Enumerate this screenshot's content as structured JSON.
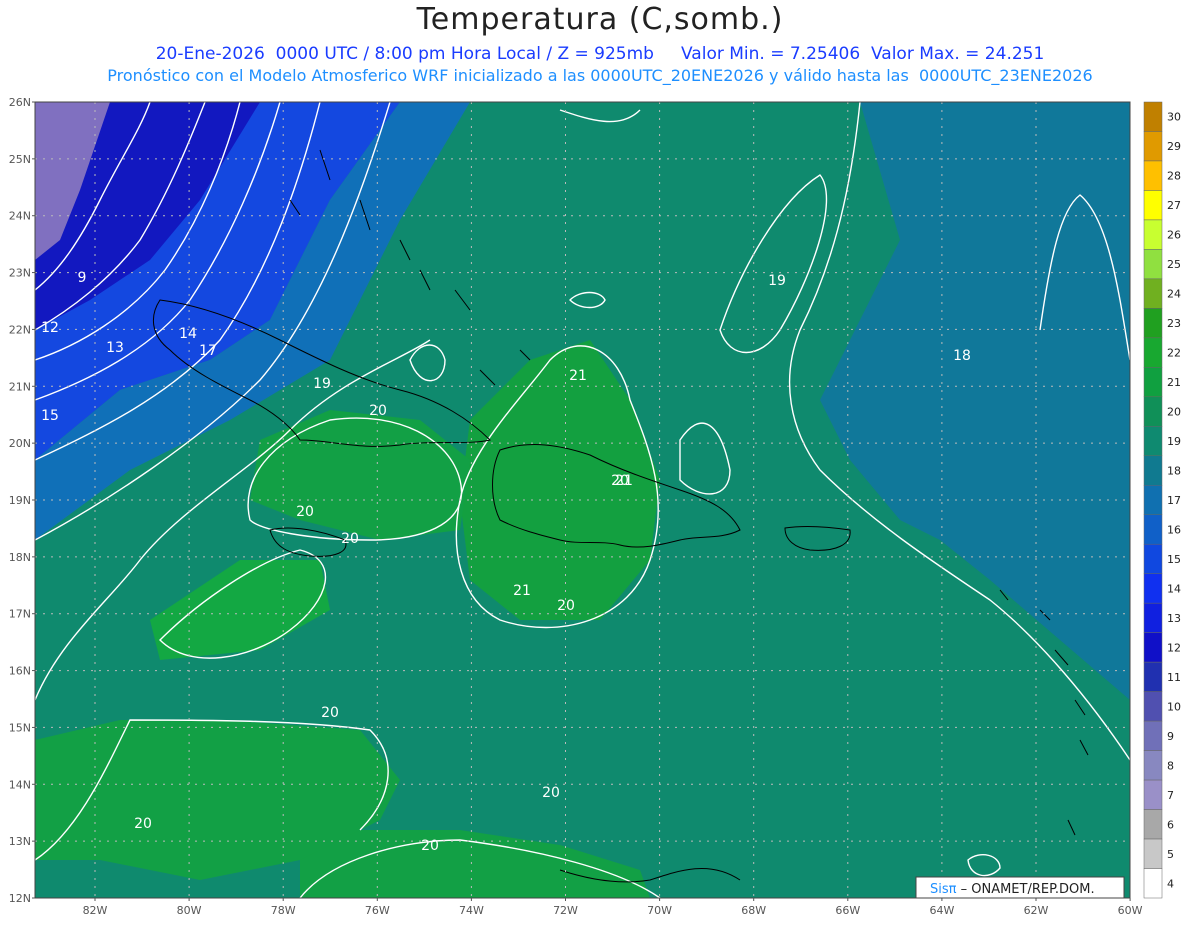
{
  "header": {
    "title": "Temperatura (C,somb.)",
    "line1": "20-Ene-2026  0000 UTC / 8:00 pm Hora Local / Z = 925mb     Valor Min. = 7.25406  Valor Max. = 24.251",
    "line2": "Pronóstico con el Modelo Atmosferico WRF inicializado a las 0000UTC_20ENE2026 y válido hasta las  0000UTC_23ENE2026"
  },
  "axes": {
    "lat_labels": [
      "26N",
      "25N",
      "24N",
      "23N",
      "22N",
      "21N",
      "20N",
      "19N",
      "18N",
      "17N",
      "16N",
      "15N",
      "14N",
      "13N",
      "12N"
    ],
    "lon_labels": [
      "82W",
      "80W",
      "78W",
      "76W",
      "74W",
      "72W",
      "70W",
      "68W",
      "66W",
      "64W",
      "62W",
      "60W"
    ]
  },
  "colorbar": {
    "levels": [
      "30",
      "29",
      "28",
      "27",
      "26",
      "25",
      "24",
      "23",
      "22",
      "21",
      "20",
      "19",
      "18",
      "17",
      "16",
      "15",
      "14",
      "13",
      "12",
      "11",
      "10",
      "9",
      "8",
      "7",
      "6",
      "5",
      "4"
    ],
    "colors": [
      "#c08000",
      "#e09a00",
      "#ffc000",
      "#ffff00",
      "#c8ff30",
      "#90e040",
      "#70b020",
      "#20a020",
      "#18a830",
      "#10a040",
      "#109058",
      "#0f8a70",
      "#107a90",
      "#1070b0",
      "#1060c8",
      "#1048e0",
      "#1030f0",
      "#1020e0",
      "#1010c8",
      "#2030b0",
      "#5050b0",
      "#7070b8",
      "#8888c0",
      "#9a90c8",
      "#a8a8a8",
      "#c8c8c8",
      "#ffffff"
    ]
  },
  "contour_labels": [
    "9",
    "12",
    "13",
    "14",
    "15",
    "17",
    "19",
    "20",
    "20",
    "20",
    "20",
    "20",
    "21",
    "21",
    "21",
    "20",
    "20",
    "20",
    "19",
    "18",
    "20"
  ],
  "credit": {
    "sis": "Sisπ",
    "rest": " – ONAMET/REP.DOM."
  }
}
